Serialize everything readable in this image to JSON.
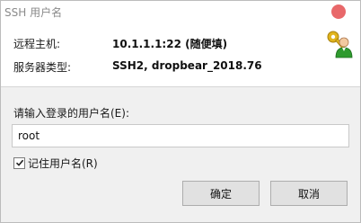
{
  "window": {
    "title": "SSH 用户名"
  },
  "info": {
    "host_label": "远程主机:",
    "host_value": "10.1.1.1:22 (随便填)",
    "server_type_label": "服务器类型:",
    "server_type_value": "SSH2, dropbear_2018.76"
  },
  "form": {
    "prompt": "请输入登录的用户名(E):",
    "username_value": "root",
    "remember_label": "记住用户名(R)",
    "remember_checked": true
  },
  "buttons": {
    "ok_label": "确定",
    "cancel_label": "取消"
  },
  "colors": {
    "close_button": "#e8686a",
    "panel_background": "#f0f0f0",
    "icon_person": "#2e9a2e",
    "icon_key": "#e0b41c"
  },
  "icons": {
    "header": "user-key-icon",
    "close": "close-icon",
    "checkbox": "checkmark-icon"
  }
}
